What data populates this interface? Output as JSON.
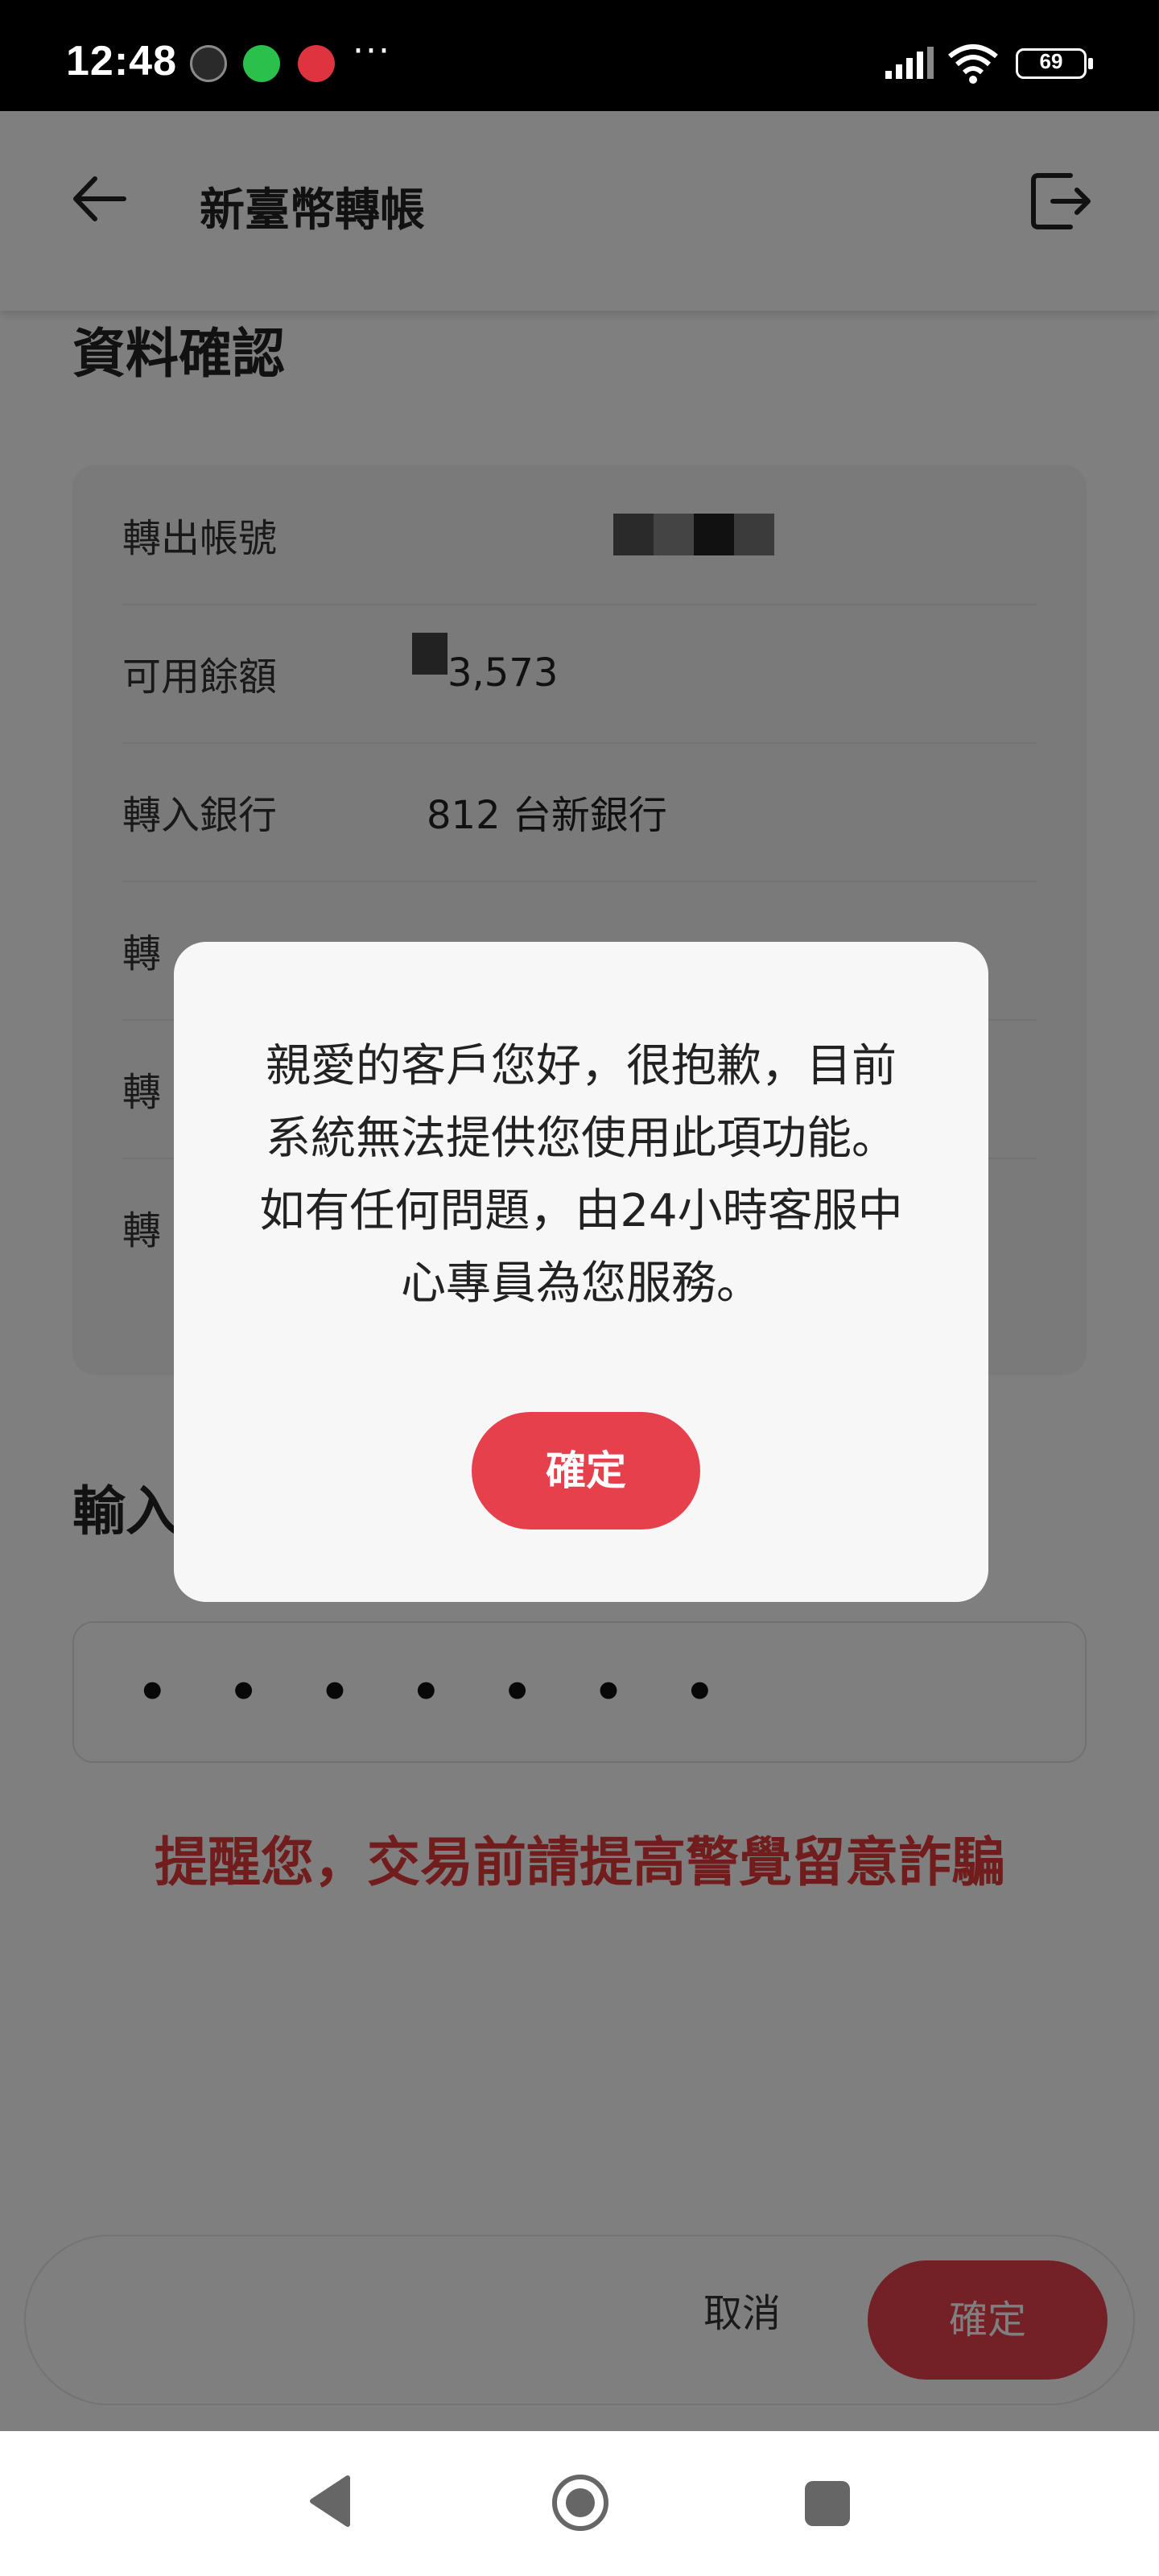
{
  "status_bar": {
    "time": "12:48",
    "more": "···",
    "battery": "69"
  },
  "header": {
    "title": "新臺幣轉帳"
  },
  "confirm_section": {
    "title": "資料確認",
    "rows": [
      {
        "label": "轉出帳號",
        "value": ""
      },
      {
        "label": "可用餘額",
        "value": "3,573"
      },
      {
        "label": "轉入銀行",
        "value": "812 台新銀行"
      },
      {
        "label": "轉",
        "value": ""
      },
      {
        "label": "轉",
        "value": ""
      },
      {
        "label": "轉",
        "value": ""
      }
    ]
  },
  "password_section": {
    "title": "輸入",
    "masked": "• • • • • • •"
  },
  "warning": "提醒您，交易前請提高警覺留意詐騙",
  "action_bar": {
    "cancel_label": "取消",
    "confirm_label": "確定"
  },
  "dialog": {
    "message": "親愛的客戶您好，很抱歉，目前系統無法提供您使用此項功能。 如有任何問題，由24小時客服中心專員為您服務。",
    "confirm_label": "確定"
  },
  "colors": {
    "accent": "#e6404d",
    "warning": "#e43a3a"
  }
}
